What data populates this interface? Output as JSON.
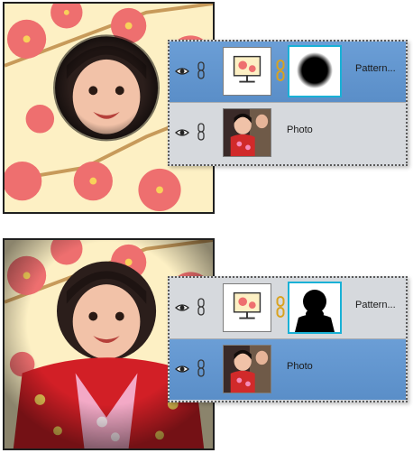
{
  "examples": [
    {
      "layers": [
        {
          "name": "Pattern...",
          "selected": true,
          "thumb": "pattern-thumb-icon",
          "mask": "circle-mask"
        },
        {
          "name": "Photo",
          "selected": false,
          "thumb": "photo-thumb"
        }
      ]
    },
    {
      "layers": [
        {
          "name": "Pattern...",
          "selected": false,
          "thumb": "pattern-thumb-icon",
          "mask": "silhouette-mask"
        },
        {
          "name": "Photo",
          "selected": true,
          "thumb": "photo-thumb"
        }
      ]
    }
  ],
  "colors": {
    "selected_row": "#5a8ec8",
    "panel_bg": "#d6d9dd",
    "mask_border": "#19b1d6",
    "blossom": "#ee6f6f",
    "background_cream": "#fdf0c4"
  }
}
